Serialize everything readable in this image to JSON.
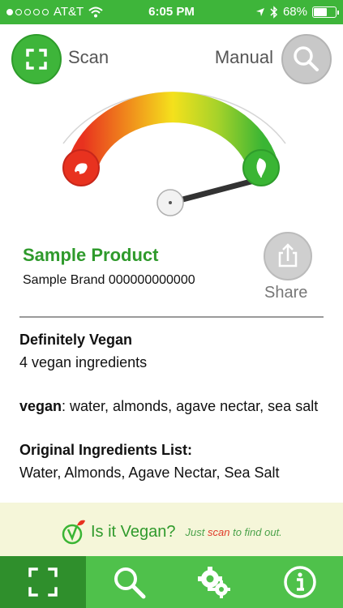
{
  "status_bar": {
    "carrier": "AT&T",
    "time": "6:05 PM",
    "battery": "68%",
    "battery_level": 0.68
  },
  "controls": {
    "scan_label": "Scan",
    "manual_label": "Manual"
  },
  "gauge": {
    "needle_level": 0.95
  },
  "product": {
    "name": "Sample Product",
    "brand_code": "Sample Brand 000000000000",
    "share_label": "Share"
  },
  "content": {
    "verdict_title": "Definitely Vegan",
    "verdict_detail": "4 vegan ingredients",
    "vegan_label": "vegan",
    "vegan_list": ": water, almonds, agave nectar, sea salt",
    "original_title": "Original Ingredients List:",
    "original_list": "Water, Almonds, Agave Nectar, Sea Salt"
  },
  "banner": {
    "title": "Is it Vegan?",
    "tag_prefix": "Just ",
    "tag_scan": "scan",
    "tag_suffix": " to find out."
  },
  "tabs": [
    {
      "icon": "scan-icon",
      "active": true
    },
    {
      "icon": "search-icon",
      "active": false
    },
    {
      "icon": "settings-icon",
      "active": false
    },
    {
      "icon": "info-icon",
      "active": false
    }
  ],
  "colors": {
    "green": "#3eb53a",
    "dark_green": "#2f8f2c",
    "text_green": "#2f9a2c",
    "red": "#e53a24",
    "yellow": "#f4e11c"
  }
}
